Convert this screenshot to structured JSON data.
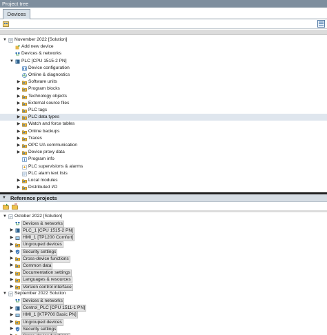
{
  "window": {
    "title": "Project tree"
  },
  "tabs": [
    {
      "label": "Devices"
    }
  ],
  "colors": {
    "accent": "#7e8e9e",
    "selected_row": "#dfe6ee",
    "reference_label_box": "#e3e3e3",
    "plc_icon": "#2d5f8a",
    "folder_icon": "#e8b23a",
    "blue_icon": "#3e78b8",
    "green_icon": "#3a9a4a"
  },
  "project_tree": {
    "rows": [
      {
        "label": "November 2022 [Solution]",
        "indent": 0,
        "expander": "expanded",
        "icon": "project-icon"
      },
      {
        "label": "Add new device",
        "indent": 1,
        "expander": "none",
        "icon": "add-device-icon"
      },
      {
        "label": "Devices & networks",
        "indent": 1,
        "expander": "none",
        "icon": "network-icon"
      },
      {
        "label": "PLC [CPU 1515-2 PN]",
        "indent": 1,
        "expander": "expanded",
        "icon": "plc-icon"
      },
      {
        "label": "Device configuration",
        "indent": 2,
        "expander": "none",
        "icon": "device-config-icon"
      },
      {
        "label": "Online & diagnostics",
        "indent": 2,
        "expander": "none",
        "icon": "diagnostics-icon"
      },
      {
        "label": "Software units",
        "indent": 2,
        "expander": "collapsed",
        "icon": "folder-icon"
      },
      {
        "label": "Program blocks",
        "indent": 2,
        "expander": "collapsed",
        "icon": "folder-icon"
      },
      {
        "label": "Technology objects",
        "indent": 2,
        "expander": "collapsed",
        "icon": "folder-icon"
      },
      {
        "label": "External source files",
        "indent": 2,
        "expander": "collapsed",
        "icon": "folder-icon"
      },
      {
        "label": "PLC tags",
        "indent": 2,
        "expander": "collapsed",
        "icon": "folder-icon"
      },
      {
        "label": "PLC data types",
        "indent": 2,
        "expander": "collapsed",
        "icon": "folder-icon",
        "selected": true
      },
      {
        "label": "Watch and force tables",
        "indent": 2,
        "expander": "collapsed",
        "icon": "folder-icon"
      },
      {
        "label": "Online backups",
        "indent": 2,
        "expander": "collapsed",
        "icon": "folder-icon"
      },
      {
        "label": "Traces",
        "indent": 2,
        "expander": "collapsed",
        "icon": "folder-icon"
      },
      {
        "label": "OPC UA communication",
        "indent": 2,
        "expander": "collapsed",
        "icon": "folder-icon"
      },
      {
        "label": "Device proxy data",
        "indent": 2,
        "expander": "collapsed",
        "icon": "folder-icon"
      },
      {
        "label": "Program info",
        "indent": 2,
        "expander": "none",
        "icon": "program-info-icon"
      },
      {
        "label": "PLC supervisions & alarms",
        "indent": 2,
        "expander": "none",
        "icon": "alarm-icon"
      },
      {
        "label": "PLC alarm text lists",
        "indent": 2,
        "expander": "none",
        "icon": "text-list-icon"
      },
      {
        "label": "Local modules",
        "indent": 2,
        "expander": "collapsed",
        "icon": "folder-icon"
      },
      {
        "label": "Distributed I/O",
        "indent": 2,
        "expander": "collapsed",
        "icon": "folder-icon"
      }
    ]
  },
  "reference_projects": {
    "title": "Reference projects",
    "rows": [
      {
        "label": "October 2022 [Solution]",
        "indent": 0,
        "expander": "expanded",
        "icon": "project-icon"
      },
      {
        "label": "Devices & networks",
        "indent": 1,
        "expander": "none",
        "icon": "network-icon"
      },
      {
        "label": "PLC_1 [CPU 1515-2 PN]",
        "indent": 1,
        "expander": "collapsed",
        "icon": "plc-icon"
      },
      {
        "label": "HMI_1 [TP1200 Comfort]",
        "indent": 1,
        "expander": "collapsed",
        "icon": "hmi-icon"
      },
      {
        "label": "Ungrouped devices",
        "indent": 1,
        "expander": "collapsed",
        "icon": "folder-icon"
      },
      {
        "label": "Security settings",
        "indent": 1,
        "expander": "collapsed",
        "icon": "security-icon"
      },
      {
        "label": "Cross-device functions",
        "indent": 1,
        "expander": "collapsed",
        "icon": "folder-icon"
      },
      {
        "label": "Common data",
        "indent": 1,
        "expander": "collapsed",
        "icon": "folder-icon"
      },
      {
        "label": "Documentation settings",
        "indent": 1,
        "expander": "collapsed",
        "icon": "folder-icon"
      },
      {
        "label": "Languages & resources",
        "indent": 1,
        "expander": "collapsed",
        "icon": "folder-icon"
      },
      {
        "label": "Version control interface",
        "indent": 1,
        "expander": "collapsed",
        "icon": "folder-icon"
      },
      {
        "label": "September 2022 Solution",
        "indent": 0,
        "expander": "expanded",
        "icon": "project-icon"
      },
      {
        "label": "Devices & networks",
        "indent": 1,
        "expander": "none",
        "icon": "network-icon"
      },
      {
        "label": "Control_PLC [CPU 1511-1 PN]",
        "indent": 1,
        "expander": "collapsed",
        "icon": "plc-icon"
      },
      {
        "label": "HMI_1 [KTP700 Basic PN]",
        "indent": 1,
        "expander": "collapsed",
        "icon": "hmi-icon"
      },
      {
        "label": "Ungrouped devices",
        "indent": 1,
        "expander": "collapsed",
        "icon": "folder-icon"
      },
      {
        "label": "Security settings",
        "indent": 1,
        "expander": "collapsed",
        "icon": "security-icon"
      },
      {
        "label": "Cross-device functions",
        "indent": 1,
        "expander": "collapsed",
        "icon": "folder-icon"
      }
    ]
  }
}
